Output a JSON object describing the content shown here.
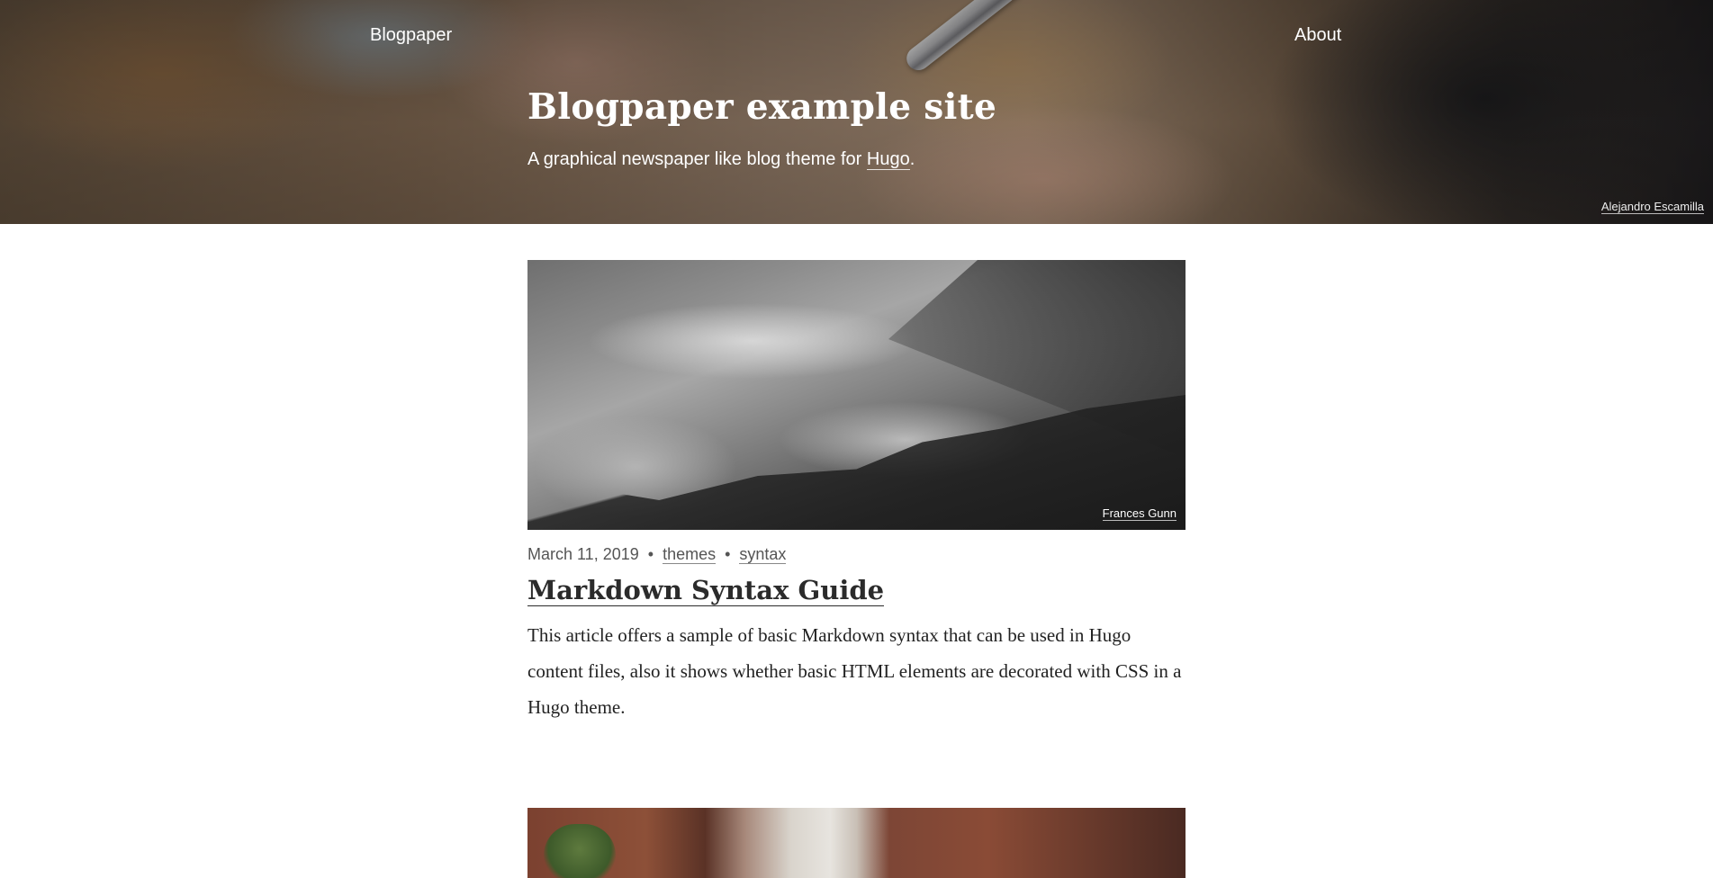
{
  "nav": {
    "brand": "Blogpaper",
    "about": "About"
  },
  "hero": {
    "title": "Blogpaper example site",
    "tagline_prefix": "A graphical newspaper like blog theme for ",
    "tagline_link": "Hugo",
    "tagline_suffix": ".",
    "photo_credit": "Alejandro Escamilla"
  },
  "posts": [
    {
      "image_credit": "Frances Gunn",
      "date": "March 11, 2019",
      "separator": "•",
      "tags": [
        "themes",
        "syntax"
      ],
      "title": "Markdown Syntax Guide",
      "excerpt": "This article offers a sample of basic Markdown syntax that can be used in Hugo content files, also it shows whether basic HTML elements are decorated with CSS in a Hugo theme."
    },
    {
      "image_credit": ""
    }
  ]
}
